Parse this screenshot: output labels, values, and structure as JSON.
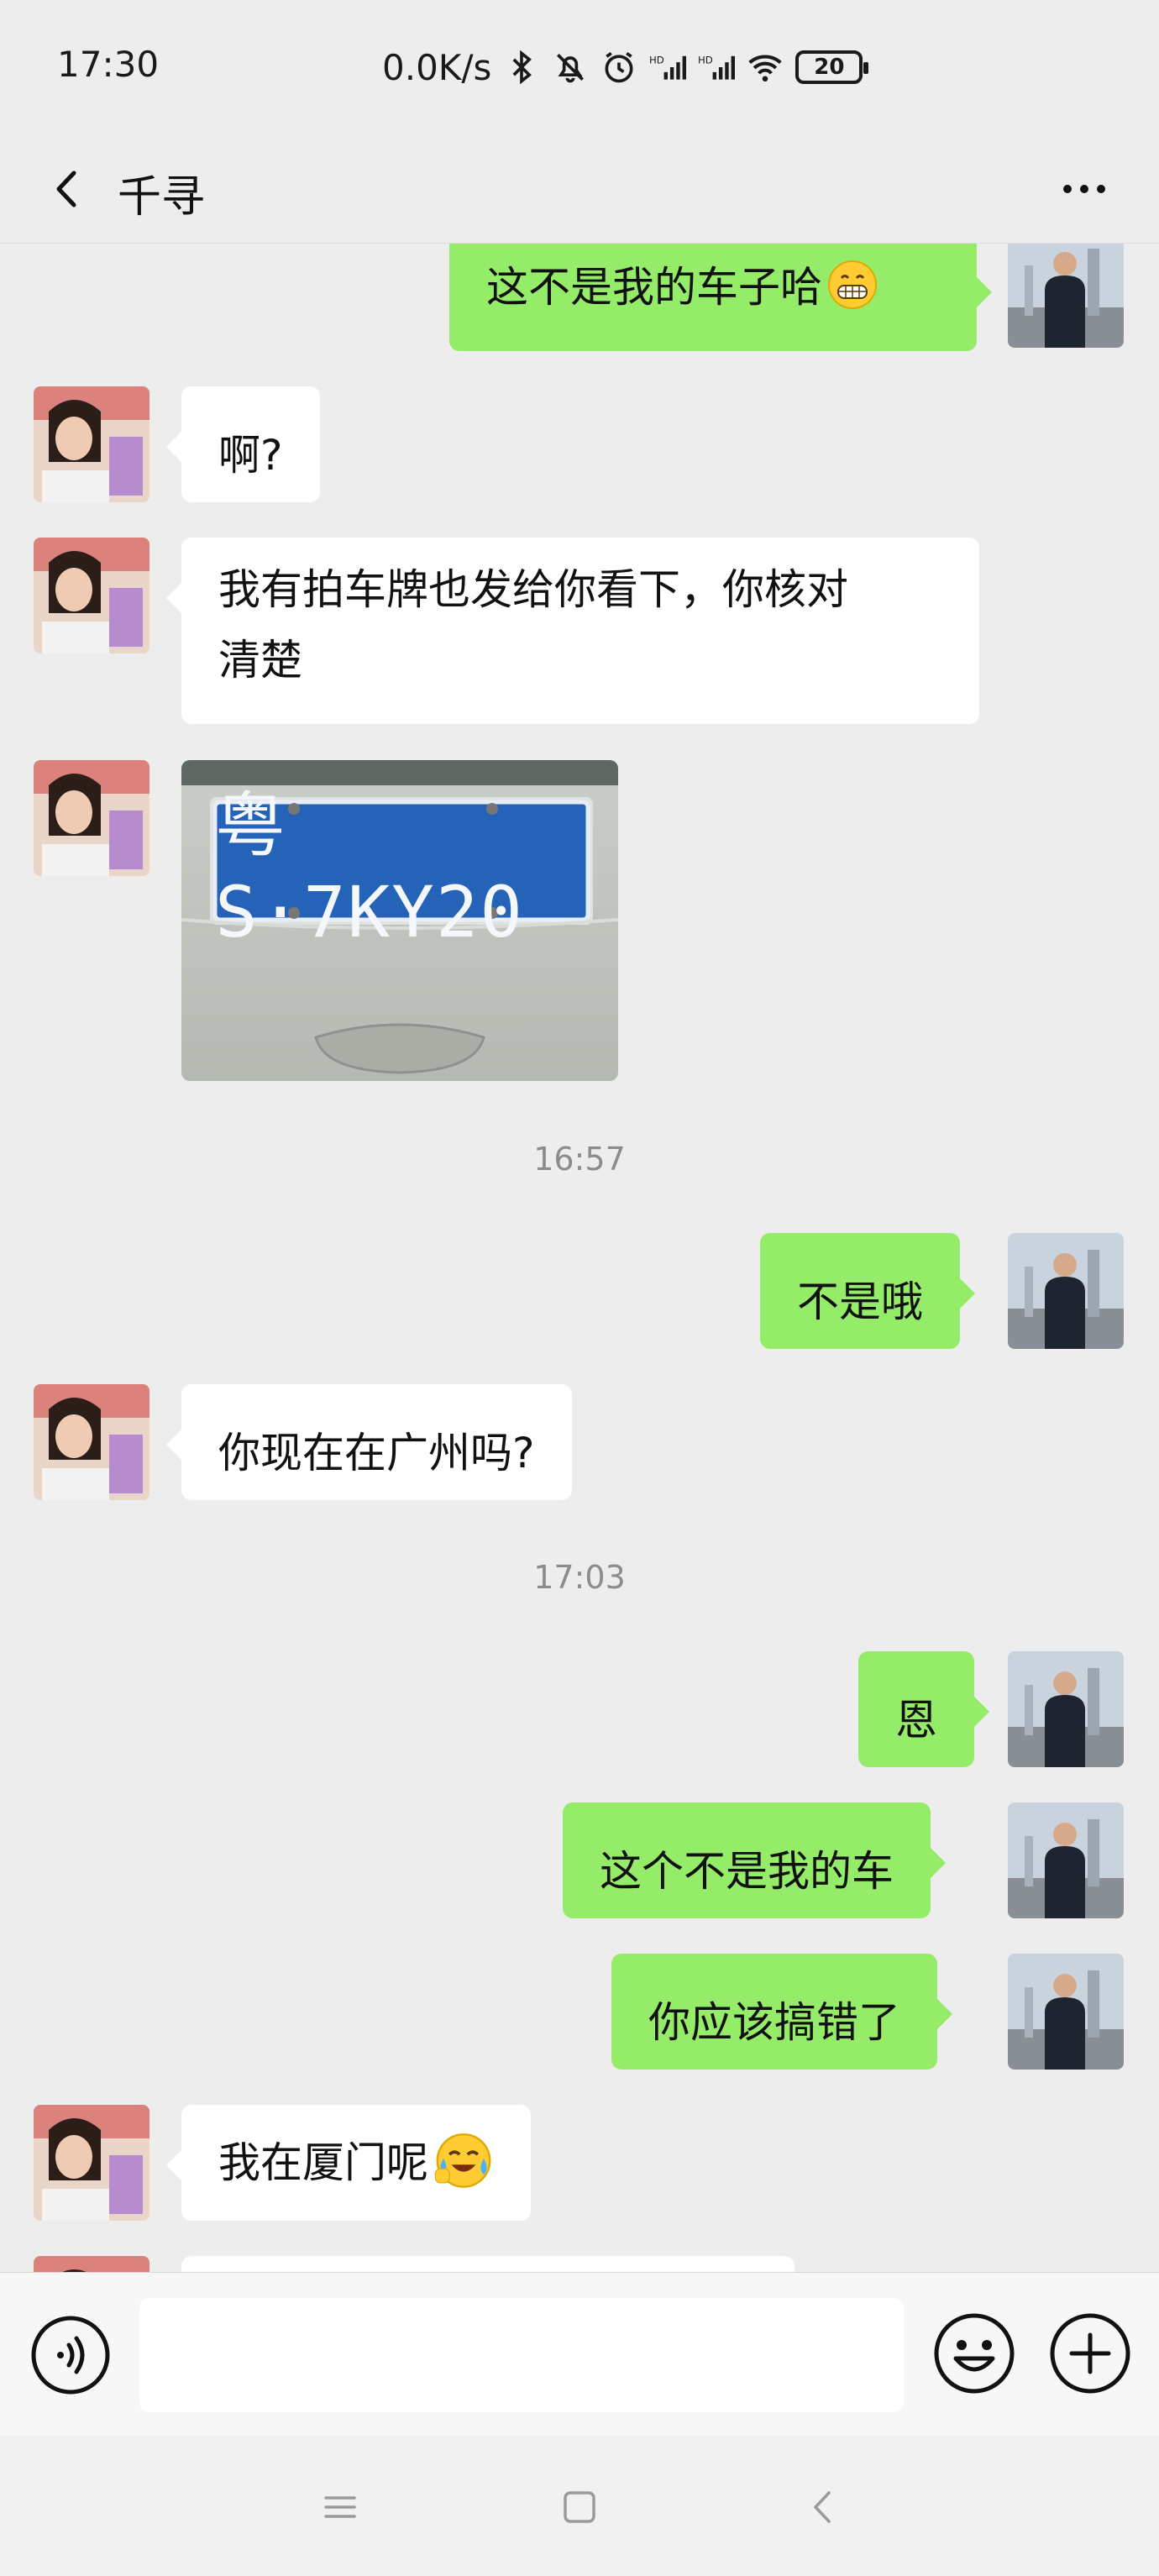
{
  "status_bar": {
    "time": "17:30",
    "net_speed": "0.0K/s",
    "battery": "20",
    "icons": [
      "bluetooth-icon",
      "mute-icon",
      "alarm-icon",
      "hd-signal-icon",
      "hd-signal-icon",
      "wifi-icon",
      "battery-icon"
    ]
  },
  "header": {
    "title": "千寻",
    "back_icon": "chevron-left-icon",
    "more_icon": "more-dots-icon"
  },
  "messages": [
    {
      "type": "text",
      "side": "out",
      "text": "这不是我的车子哈",
      "emoji": "grimace-emoji"
    },
    {
      "type": "text",
      "side": "in",
      "text": "啊?"
    },
    {
      "type": "text",
      "side": "in",
      "lines": [
        "我有拍车牌也发给你看下，你核对",
        "清楚"
      ]
    },
    {
      "type": "image",
      "side": "in",
      "plate": "粤S·7KY20"
    },
    {
      "type": "timestamp",
      "text": "16:57"
    },
    {
      "type": "text",
      "side": "out",
      "text": "不是哦"
    },
    {
      "type": "text",
      "side": "in",
      "text": "你现在在广州吗?"
    },
    {
      "type": "timestamp",
      "text": "17:03"
    },
    {
      "type": "text",
      "side": "out",
      "text": "恩"
    },
    {
      "type": "text",
      "side": "out",
      "text": "这个不是我的车"
    },
    {
      "type": "text",
      "side": "out",
      "text": "你应该搞错了"
    },
    {
      "type": "text",
      "side": "in",
      "text": "我在厦门呢",
      "emoji": "crying-laughing-emoji"
    }
  ],
  "input_bar": {
    "voice_icon": "voice-icon",
    "text_value": "",
    "emoji_icon": "smile-icon",
    "plus_icon": "plus-icon"
  },
  "nav_bar": {
    "icons": [
      "menu-icon",
      "home-icon",
      "back-icon"
    ]
  },
  "colors": {
    "outgoing_bubble": "#95ec69",
    "incoming_bubble": "#ffffff",
    "background": "#ededed"
  }
}
